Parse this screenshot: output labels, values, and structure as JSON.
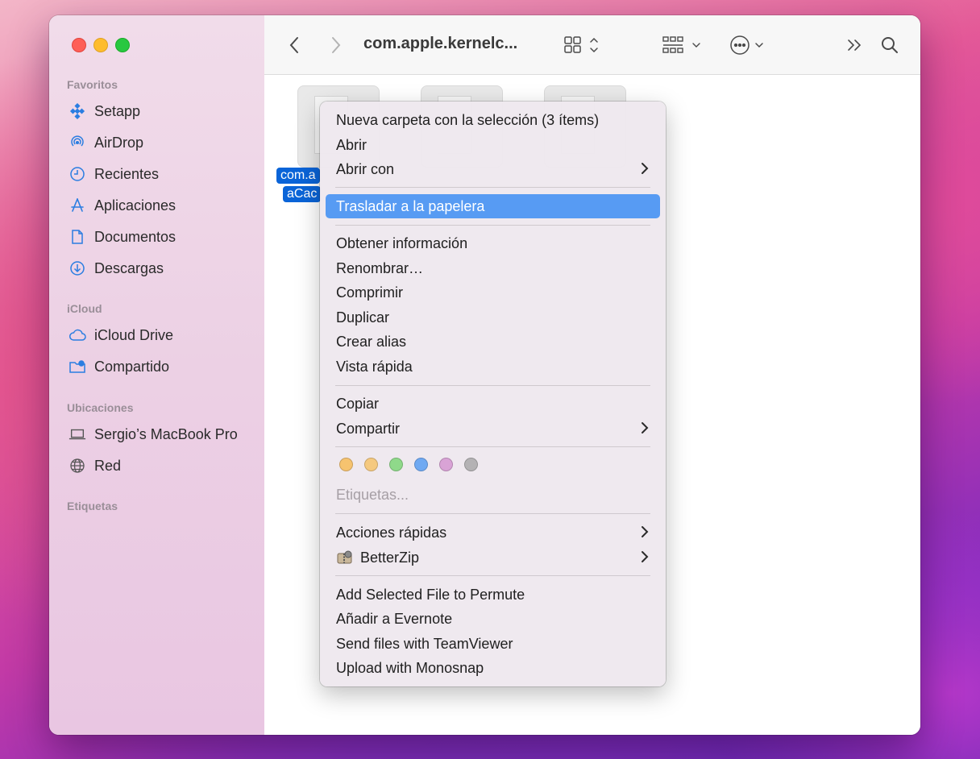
{
  "window": {
    "title": "com.apple.kernelc...",
    "selected_file_line1": "com.a",
    "selected_file_line2": "aCac"
  },
  "sidebar": {
    "favorites_title": "Favoritos",
    "favorites": [
      {
        "label": "Setapp",
        "icon": "setapp-icon"
      },
      {
        "label": "AirDrop",
        "icon": "airdrop-icon"
      },
      {
        "label": "Recientes",
        "icon": "clock-icon"
      },
      {
        "label": "Aplicaciones",
        "icon": "applications-icon"
      },
      {
        "label": "Documentos",
        "icon": "document-icon"
      },
      {
        "label": "Descargas",
        "icon": "download-icon"
      }
    ],
    "icloud_title": "iCloud",
    "icloud": [
      {
        "label": "iCloud Drive",
        "icon": "cloud-icon"
      },
      {
        "label": "Compartido",
        "icon": "shared-folder-icon"
      }
    ],
    "locations_title": "Ubicaciones",
    "locations": [
      {
        "label": "Sergio’s MacBook Pro",
        "icon": "laptop-icon"
      },
      {
        "label": "Red",
        "icon": "network-globe-icon"
      }
    ],
    "tags_title": "Etiquetas"
  },
  "context_menu": {
    "new_folder": "Nueva carpeta con la selección (3 ítems)",
    "open": "Abrir",
    "open_with": "Abrir con",
    "move_to_trash": "Trasladar a la papelera",
    "get_info": "Obtener información",
    "rename": "Renombrar…",
    "compress": "Comprimir",
    "duplicate": "Duplicar",
    "make_alias": "Crear alias",
    "quick_look": "Vista rápida",
    "copy": "Copiar",
    "share": "Compartir",
    "tags": "Etiquetas...",
    "quick_actions": "Acciones rápidas",
    "betterzip": "BetterZip",
    "permute": "Add Selected File to Permute",
    "evernote": "Añadir a Evernote",
    "teamviewer": "Send files with TeamViewer",
    "monosnap": "Upload with Monosnap",
    "tag_colors": [
      "#f6c36f",
      "#f5c97f",
      "#8fd98a",
      "#6fa9f2",
      "#d9a3d6",
      "#b4b2b4"
    ],
    "highlight_color": "#579bf3"
  }
}
